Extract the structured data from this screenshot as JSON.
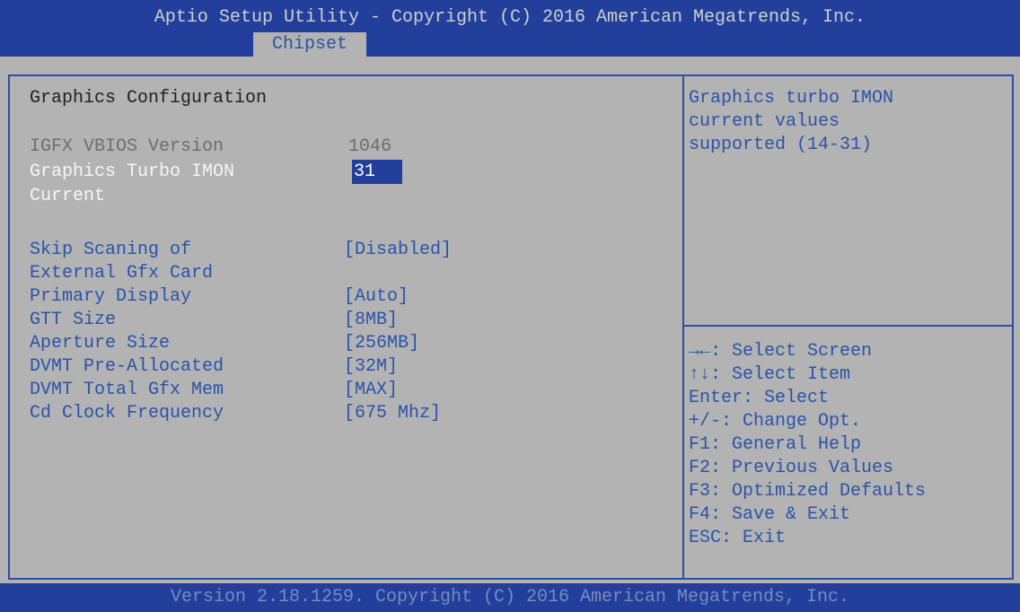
{
  "header": {
    "title": "Aptio Setup Utility - Copyright (C) 2016 American Megatrends, Inc.",
    "active_tab": "Chipset"
  },
  "main": {
    "section_title": "Graphics Configuration",
    "info": {
      "label": "IGFX VBIOS Version",
      "value": "1046"
    },
    "selected_item": {
      "label_line1": "Graphics Turbo IMON",
      "label_line2": "Current",
      "value": "31"
    },
    "settings": [
      {
        "label": "Skip Scaning of",
        "label2": "External Gfx Card",
        "value": "[Disabled]"
      },
      {
        "label": "Primary Display",
        "value": "[Auto]"
      },
      {
        "label": "GTT Size",
        "value": "[8MB]"
      },
      {
        "label": "Aperture Size",
        "value": "[256MB]"
      },
      {
        "label": "DVMT Pre-Allocated",
        "value": "[32M]"
      },
      {
        "label": "DVMT Total Gfx Mem",
        "value": "[MAX]"
      },
      {
        "label": "Cd Clock Frequency",
        "value": "[675 Mhz]"
      }
    ]
  },
  "help": {
    "description": [
      "Graphics turbo IMON",
      "current values",
      "supported (14-31)"
    ],
    "keys": [
      "→←: Select Screen",
      "↑↓: Select Item",
      "Enter: Select",
      "+/-: Change Opt.",
      "F1: General Help",
      "F2: Previous Values",
      "F3: Optimized Defaults",
      "F4: Save & Exit",
      "ESC: Exit"
    ]
  },
  "footer": {
    "text": "Version 2.18.1259. Copyright (C) 2016 American Megatrends, Inc."
  },
  "colors": {
    "header_bg": "#213f9b",
    "panel_bg": "#b3b3b3",
    "accent_blue": "#2a53a8",
    "border": "#2c4ea5"
  }
}
